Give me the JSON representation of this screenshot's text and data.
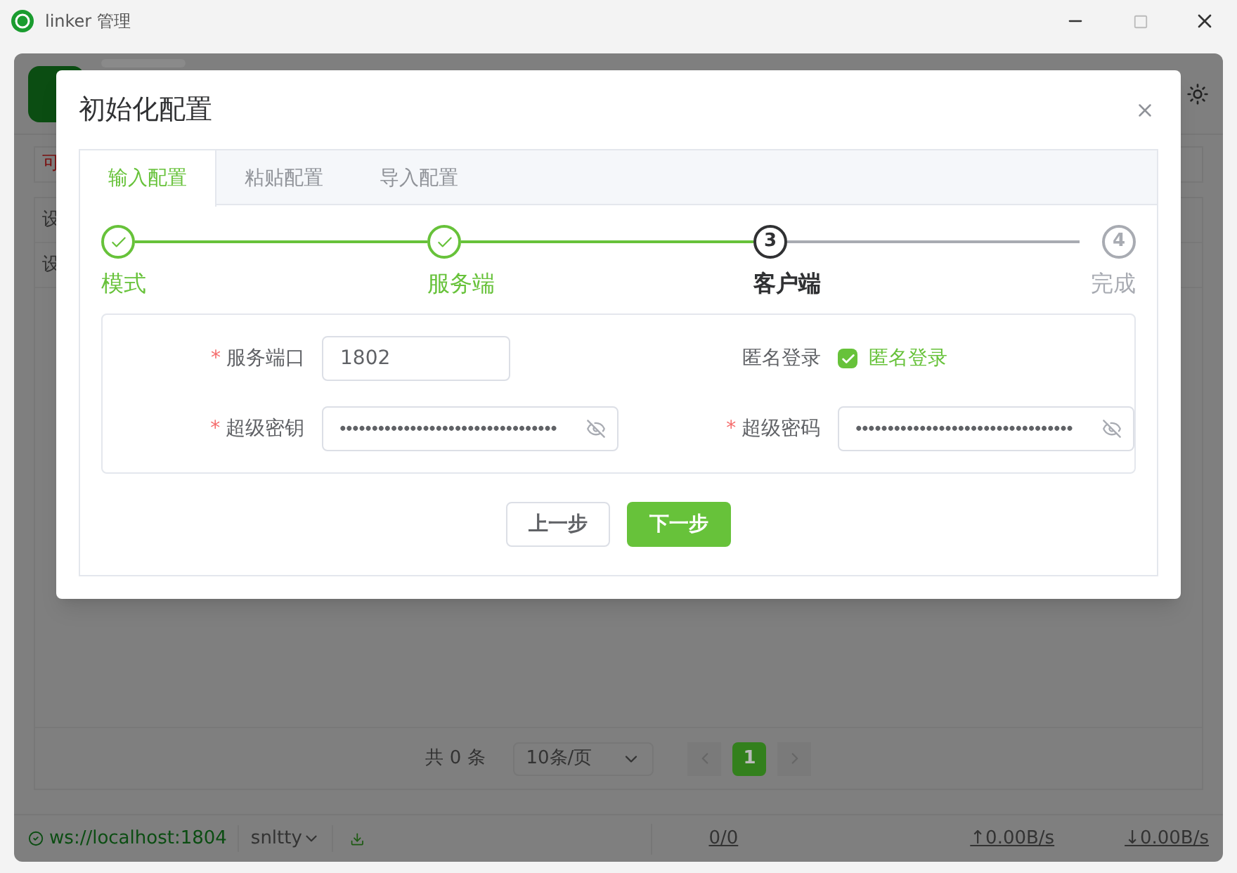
{
  "window": {
    "title": "linker 管理"
  },
  "background": {
    "alert_fragment": "可",
    "row_fragments": [
      "设",
      "设"
    ],
    "pagination": {
      "total": "共 0 条",
      "page_size": "10条/页",
      "pages": [
        {
          "label": "1",
          "selected": true
        }
      ]
    },
    "status_bar": {
      "connection": "ws://localhost:1804",
      "user": "snltty",
      "counts": "0/0",
      "upload": "↑0.00B/s",
      "download": "↓0.00B/s"
    }
  },
  "dialog": {
    "title": "初始化配置",
    "tabs": [
      {
        "label": "输入配置",
        "selected": true
      },
      {
        "label": "粘贴配置",
        "selected": false
      },
      {
        "label": "导入配置",
        "selected": false
      }
    ],
    "steps": [
      {
        "label": "模式",
        "finished": true,
        "selected": false
      },
      {
        "label": "服务端",
        "finished": true,
        "selected": false
      },
      {
        "number": "3",
        "label": "客户端",
        "finished": false,
        "selected": true
      },
      {
        "number": "4",
        "label": "完成",
        "finished": false,
        "selected": false
      }
    ],
    "fields": [
      {
        "required_mark": "*",
        "label": "服务端口",
        "value": "1802",
        "kind": "text"
      },
      {
        "label": "匿名登录",
        "value": "匿名登录",
        "kind": "checkbox",
        "checked": true
      },
      {
        "required_mark": "*",
        "label": "超级密钥",
        "value": "••••••••••••••••••••••••••••••••••",
        "kind": "password"
      },
      {
        "required_mark": "*",
        "label": "超级密码",
        "value": "••••••••••••••••••••••••••••••••••",
        "kind": "password"
      }
    ],
    "buttons": [
      {
        "label": "上一步",
        "kind": "default"
      },
      {
        "label": "下一步",
        "kind": "primary"
      }
    ]
  }
}
